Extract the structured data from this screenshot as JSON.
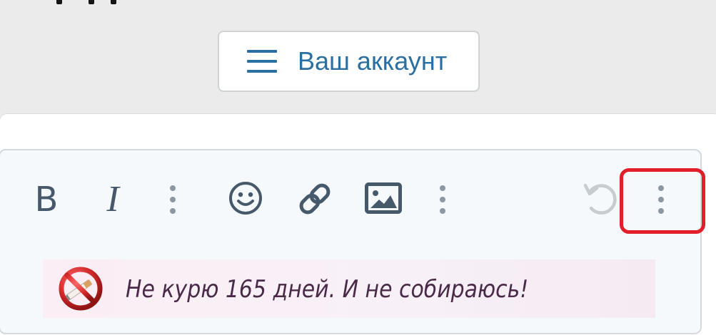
{
  "header": {
    "account_button": {
      "label": "Ваш аккаунт",
      "icon": "menu-icon"
    }
  },
  "editor": {
    "toolbar": {
      "bold_label": "B",
      "italic_label": "I",
      "icons": [
        "more-options-icon",
        "emoji-icon",
        "link-icon",
        "image-icon",
        "more-options-icon",
        "undo-icon",
        "more-options-icon"
      ]
    },
    "signature": {
      "text": "Не курю 165 дней. И не собираюсь!",
      "icon": "no-smoking-icon"
    }
  },
  "colors": {
    "page_background": "#ebebeb",
    "accent": "#2b6fa0",
    "toolbar_icon": "#46596b",
    "toolbar_dots": "#8b98a4",
    "undo_disabled": "#c7ccd1",
    "highlight": "#e21e2a",
    "signature_text": "#4a2a48"
  }
}
